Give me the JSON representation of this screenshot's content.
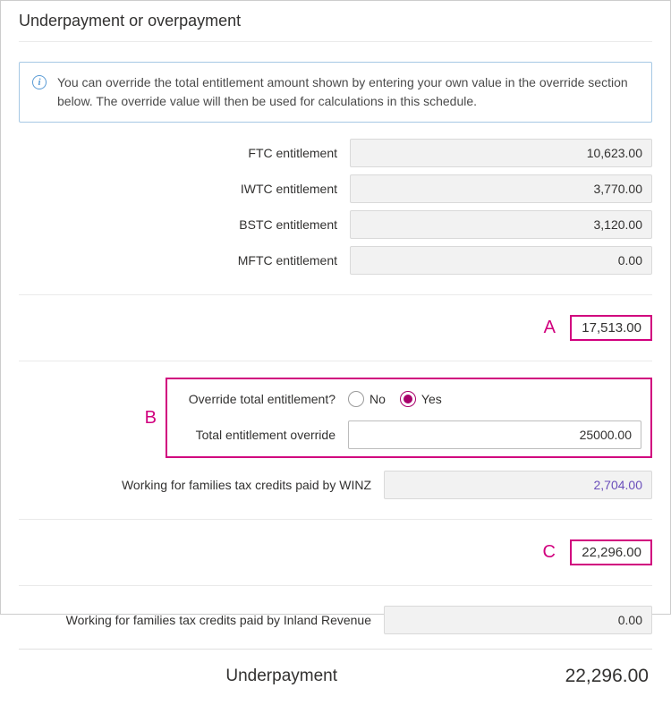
{
  "title": "Underpayment or overpayment",
  "info": "You can override the total entitlement amount shown by entering your own value in the override section below. The override value will then be used for calculations in this schedule.",
  "entitlements": {
    "ftc": {
      "label": "FTC entitlement",
      "value": "10,623.00"
    },
    "iwtc": {
      "label": "IWTC entitlement",
      "value": "3,770.00"
    },
    "bstc": {
      "label": "BSTC entitlement",
      "value": "3,120.00"
    },
    "mftc": {
      "label": "MFTC entitlement",
      "value": "0.00"
    }
  },
  "annotations": {
    "a": "A",
    "b": "B",
    "c": "C"
  },
  "total_entitlement": "17,513.00",
  "override": {
    "question": "Override total entitlement?",
    "no_label": "No",
    "yes_label": "Yes",
    "selected": "yes",
    "field_label": "Total entitlement override",
    "field_value": "25000.00"
  },
  "winz": {
    "label": "Working for families tax credits paid by WINZ",
    "value": "2,704.00"
  },
  "subtotal_c": "22,296.00",
  "ird": {
    "label": "Working for families tax credits paid by Inland Revenue",
    "value": "0.00"
  },
  "result": {
    "label": "Underpayment",
    "value": "22,296.00"
  }
}
